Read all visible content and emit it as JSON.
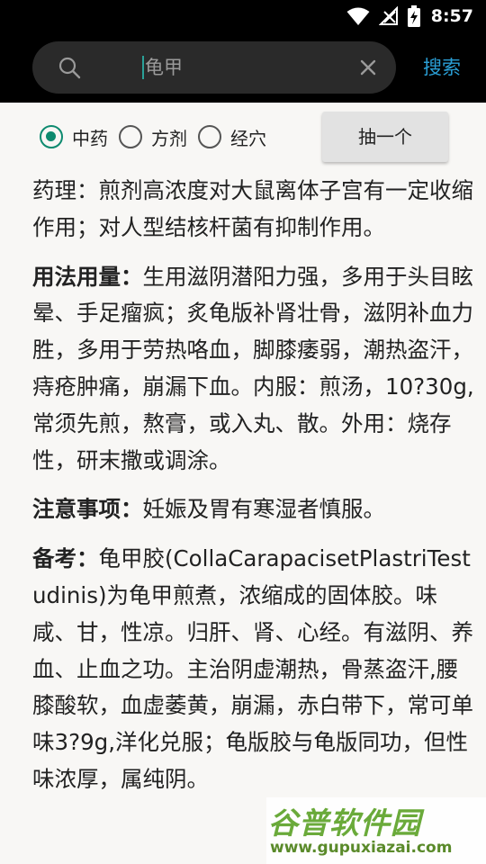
{
  "status": {
    "time": "8:57"
  },
  "search": {
    "query": "龟甲",
    "button_label": "搜索"
  },
  "filters": {
    "options": [
      {
        "label": "中药",
        "checked": true
      },
      {
        "label": "方剂",
        "checked": false
      },
      {
        "label": "经穴",
        "checked": false
      }
    ],
    "random_button": "抽一个"
  },
  "content": {
    "pharmacology_text": "药理：煎剂高浓度对大鼠离体子宫有一定收缩作用；对人型结核杆菌有抑制作用。",
    "usage_label": "用法用量：",
    "usage_text": "生用滋阴潜阳力强，多用于头目眩晕、手足瘤疯；炙龟版补肾壮骨，滋阴补血力胜，多用于劳热咯血，脚膝痿弱，潮热盗汗，痔疮肿痛，崩漏下血。内服：煎汤，10?30g,常须先煎，熬膏，或入丸、散。外用：烧存性，研末撒或调涂。",
    "caution_label": "注意事项：",
    "caution_text": "妊娠及胃有寒湿者慎服。",
    "notes_label": "备考：",
    "notes_text": "龟甲胶(CollaCarapacisetPlastriTestudinis)为龟甲煎煮，浓缩成的固体胶。味咸、甘，性凉。归肝、肾、心经。有滋阴、养血、止血之功。主治阴虚潮热，骨蒸盗汗,腰膝酸软，血虚萎黄，崩漏，赤白带下，常可单味3?9g,洋化兑服；龟版胶与龟版同功，但性味浓厚，属纯阴。"
  },
  "watermark": {
    "title": "谷普软件园",
    "url": "www.gupuxiazai.com"
  },
  "colors": {
    "accent": "#0d8a6f",
    "link": "#2a9fd6",
    "bar": "#000000"
  }
}
